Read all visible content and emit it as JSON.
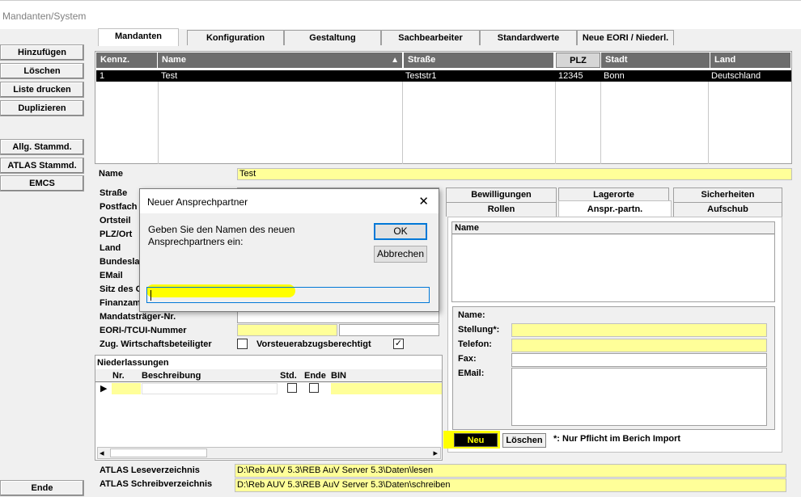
{
  "window": {
    "title": "Mandanten/System"
  },
  "left_buttons": {
    "add": "Hinzufügen",
    "delete": "Löschen",
    "print": "Liste drucken",
    "duplicate": "Duplizieren",
    "allg": "Allg. Stammd.",
    "atlas": "ATLAS Stammd.",
    "emcs": "EMCS",
    "end": "Ende"
  },
  "tabs": [
    "Mandanten",
    "Konfiguration",
    "Gestaltung",
    "Sachbearbeiter",
    "Standardwerte",
    "Neue EORI / Niederl."
  ],
  "grid": {
    "columns": [
      "Kennz.",
      "Name",
      "Straße",
      "PLZ",
      "Stadt",
      "Land"
    ],
    "rows": [
      [
        "1",
        "Test",
        "Teststr1",
        "12345",
        "Bonn",
        "Deutschland"
      ]
    ]
  },
  "form": {
    "name_label": "Name",
    "name_value": "Test",
    "labels": [
      "Straße",
      "Postfach",
      "Ortsteil",
      "PLZ/Ort",
      "Land",
      "Bundesland",
      "EMail",
      "Sitz des G",
      "Finanzamt"
    ],
    "mandatstraeger": "Mandatsträger-Nr.",
    "eori": "EORI-/TCUI-Nummer",
    "zug": "Zug. Wirtschaftsbeteiligter",
    "vorsteuer": "Vorsteuerabzugsberechtigt",
    "vorsteuer_mark": "✓"
  },
  "niederlassungen": {
    "title": "Niederlassungen",
    "columns": [
      "Nr.",
      "Beschreibung",
      "Std.",
      "Ende",
      "BIN"
    ],
    "row_marker": "▶",
    "scroll_left": "◂",
    "scroll_right": "▸"
  },
  "right_tabs": {
    "row1": [
      "Bewilligungen",
      "Lagerorte",
      "Sicherheiten"
    ],
    "row2": [
      "Rollen",
      "Anspr.-partn.",
      "Aufschub"
    ]
  },
  "contacts": {
    "list_header": "Name",
    "labels": {
      "name": "Name:",
      "stellung": "Stellung*:",
      "telefon": "Telefon:",
      "fax": "Fax:",
      "email": "EMail:"
    },
    "new_button": "Neu",
    "delete_button": "Löschen",
    "note": "*: Nur Pflicht im Berich Import"
  },
  "atlas": {
    "read_label": "ATLAS Leseverzeichnis",
    "read_value": "D:\\Reb AUV 5.3\\REB AuV Server 5.3\\Daten\\lesen",
    "write_label": "ATLAS Schreibverzeichnis",
    "write_value": "D:\\Reb AUV 5.3\\REB AuV Server 5.3\\Daten\\schreiben"
  },
  "dialog": {
    "title": "Neuer Ansprechpartner",
    "close": "✕",
    "prompt_line1": "Geben Sie den Namen des neuen",
    "prompt_line2": "Ansprechpartners ein:",
    "ok": "OK",
    "cancel": "Abbrechen",
    "input_value": ""
  },
  "colors": {
    "required_field": "#ffff99",
    "highlight": "#ffff00",
    "grid_header": "#6d6d6d",
    "selected_row": "#000000"
  }
}
